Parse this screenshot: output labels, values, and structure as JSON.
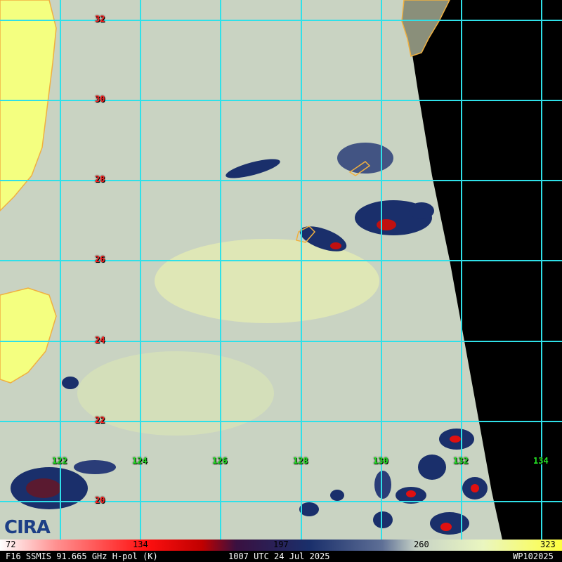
{
  "map": {
    "lat_labels": [
      "32",
      "30",
      "28",
      "26",
      "24",
      "22",
      "20"
    ],
    "lon_labels": [
      "122",
      "124",
      "126",
      "128",
      "130",
      "132",
      "134"
    ],
    "colors": {
      "grid": "#2fe0e8",
      "lat_label": "#ff2020",
      "lon_label": "#24e024",
      "coast": "#f0b040",
      "land": "#f4ff80",
      "outside_swath": "#000000"
    }
  },
  "logo": {
    "text": "CIRA",
    "icon": "cira-logo-icon"
  },
  "colorbar": {
    "ticks": [
      "72",
      "134",
      "197",
      "260",
      "323"
    ],
    "min": 72,
    "max": 323
  },
  "footer": {
    "sensor": "F16 SSMIS 91.665 GHz H-pol (K)",
    "time": "1007 UTC 24 Jul 2025",
    "storm_id": "WP102025"
  }
}
